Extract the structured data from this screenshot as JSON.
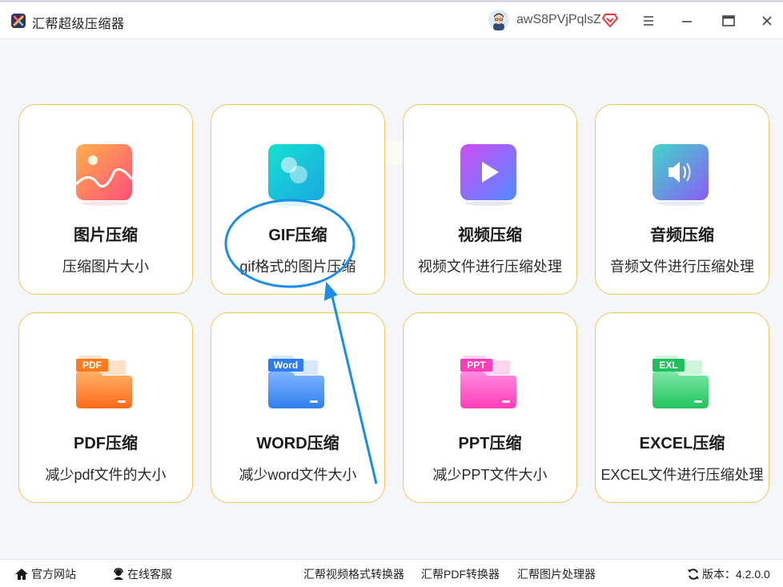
{
  "app": {
    "title": "汇帮超级压缩器",
    "username": "awS8PVjPqlsZ"
  },
  "colors": {
    "card_border": "#f2c75c",
    "annotation": "#1a8de8"
  },
  "cards": [
    {
      "title": "图片压缩",
      "desc": "压缩图片大小",
      "icon": "image-icon"
    },
    {
      "title": "GIF压缩",
      "desc": "gif格式的图片压缩",
      "icon": "gif-icon"
    },
    {
      "title": "视频压缩",
      "desc": "视频文件进行压缩处理",
      "icon": "video-play-icon"
    },
    {
      "title": "音频压缩",
      "desc": "音频文件进行压缩处理",
      "icon": "audio-speaker-icon"
    },
    {
      "title": "PDF压缩",
      "desc": "减少pdf文件的大小",
      "icon": "pdf-folder-icon",
      "badge": "PDF"
    },
    {
      "title": "WORD压缩",
      "desc": "减少word文件大小",
      "icon": "word-folder-icon",
      "badge": "Word"
    },
    {
      "title": "PPT压缩",
      "desc": "减少PPT文件大小",
      "icon": "ppt-folder-icon",
      "badge": "PPT"
    },
    {
      "title": "EXCEL压缩",
      "desc": "EXCEL文件进行压缩处理",
      "icon": "excel-folder-icon",
      "badge": "EXL"
    }
  ],
  "footer": {
    "website": "官方网站",
    "support": "在线客服",
    "video_converter": "汇帮视频格式转换器",
    "pdf_converter": "汇帮PDF转换器",
    "image_processor": "汇帮图片处理器",
    "version_label": "版本：",
    "version": "4.2.0.0"
  }
}
